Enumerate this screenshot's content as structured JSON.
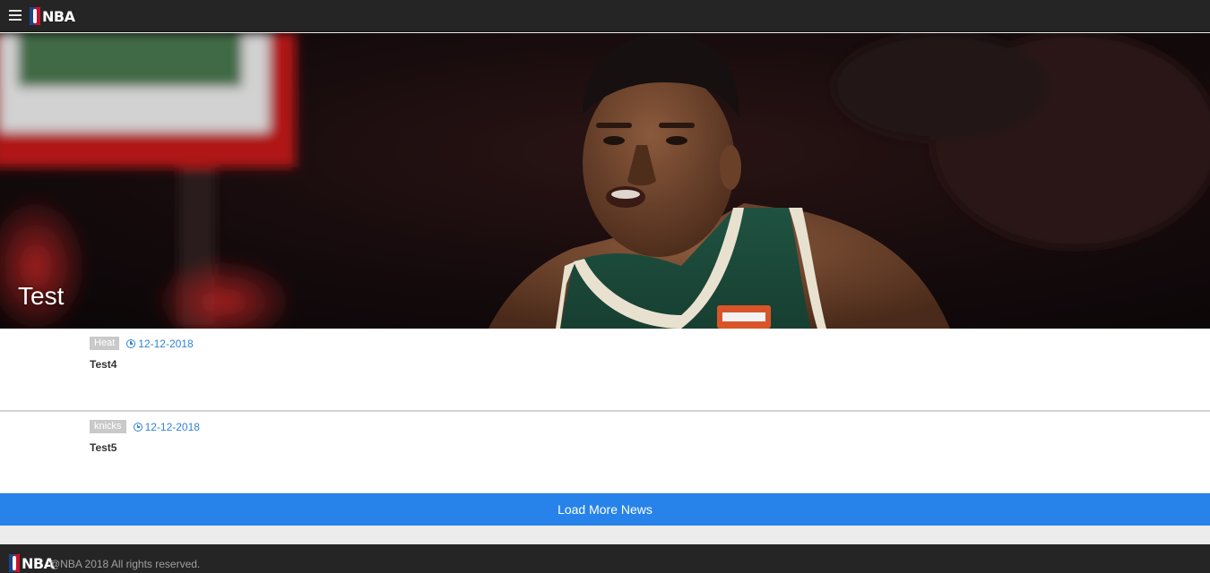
{
  "header": {
    "menu_icon": "hamburger-menu-icon",
    "logo_text": "NBA"
  },
  "hero": {
    "title": "Test"
  },
  "news": [
    {
      "tag": "Heat",
      "date": "12-12-2018",
      "title": "Test4"
    },
    {
      "tag": "knicks",
      "date": "12-12-2018",
      "title": "Test5"
    }
  ],
  "load_more_label": "Load More News",
  "footer": {
    "logo_text": "NBA",
    "copyright": "@NBA 2018 All rights reserved."
  },
  "colors": {
    "accent": "#2783ea",
    "date_blue": "#2e84d6",
    "header_bg": "#252525",
    "tag_bg": "#c9c9c9"
  }
}
